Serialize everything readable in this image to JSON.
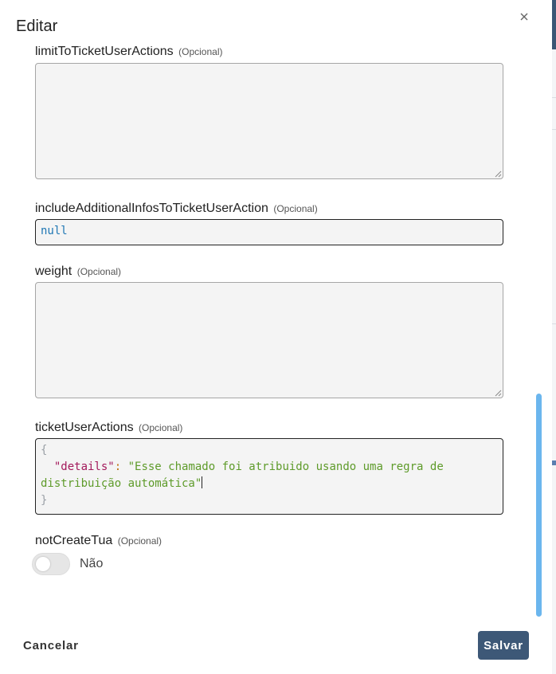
{
  "dialog": {
    "title": "Editar",
    "close_icon": "close-icon"
  },
  "fields": {
    "limit": {
      "label": "limitToTicketUserActions",
      "optional": "(Opcional)",
      "value": ""
    },
    "include": {
      "label": "includeAdditionalInfosToTicketUserAction",
      "optional": "(Opcional)",
      "value": "null"
    },
    "weight": {
      "label": "weight",
      "optional": "(Opcional)",
      "value": ""
    },
    "ticket": {
      "label": "ticketUserActions",
      "optional": "(Opcional)",
      "code": {
        "open_brace": "{",
        "key": "\"details\"",
        "colon": ":",
        "value_line1": "\"Esse chamado foi atribuido usando uma regra de",
        "value_line2": "distribuição automática\"",
        "close_brace": "}"
      }
    },
    "notCreate": {
      "label": "notCreateTua",
      "optional": "(Opcional)",
      "toggle_label": "Não",
      "checked": false
    }
  },
  "footer": {
    "cancel_label": "Cancelar",
    "save_label": "Salvar"
  },
  "colors": {
    "primary": "#3d5877",
    "scrollbar": "#6bb6ee",
    "json_key": "#a3195b",
    "json_string": "#5e9b2a",
    "json_null": "#1f77b4"
  }
}
